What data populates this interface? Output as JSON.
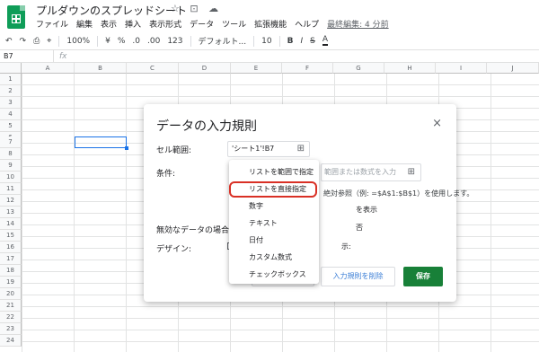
{
  "app": {
    "title": "プルダウンのスプレッドシート",
    "title_icons": "☆ ⊡ ☁",
    "menus": [
      "ファイル",
      "編集",
      "表示",
      "挿入",
      "表示形式",
      "データ",
      "ツール",
      "拡張機能",
      "ヘルプ"
    ],
    "last_edit": "最終編集: 4 分前"
  },
  "toolbar": {
    "undo": "↶",
    "redo": "↷",
    "print": "⎙",
    "paint": "⌖",
    "zoom": "100%",
    "currency": "¥",
    "percent": "%",
    "dec_less": ".0",
    "dec_more": ".00",
    "format": "123",
    "font": "デフォルト...",
    "size": "10",
    "bold": "B",
    "italic": "I",
    "strike": "S",
    "textcolor": "A"
  },
  "formula": {
    "name_box": "B7",
    "fx": "fx"
  },
  "columns": [
    "A",
    "B",
    "C",
    "D",
    "E",
    "F",
    "G",
    "H",
    "I",
    "J"
  ],
  "rows": [
    "1",
    "2",
    "3",
    "4",
    "5",
    "6",
    "7",
    "8",
    "9",
    "10",
    "11",
    "12",
    "13",
    "14",
    "15",
    "16",
    "17",
    "18",
    "19",
    "20",
    "21",
    "22",
    "23",
    "24"
  ],
  "dialog": {
    "title": "データの入力規則",
    "close": "×",
    "range_label": "セル範囲:",
    "range_value": "'シート1'!B7",
    "criteria_label": "条件:",
    "criteria_placeholder": "範囲または数式を入力",
    "hint": "絶対参照（例: =$A$1:$B$1）を使用します。",
    "show_dropdown": "を表示",
    "invalid_label": "無効なデータの場合:",
    "reject": "否",
    "design_label": "デザイン:",
    "help_text": "示:",
    "delete_button": "入力規則を削除",
    "save_button": "保存",
    "grid_icon": "⊞"
  },
  "menu": {
    "items": [
      "リストを範囲で指定",
      "リストを直接指定",
      "数字",
      "テキスト",
      "日付",
      "カスタム数式",
      "チェックボックス"
    ],
    "highlighted_index": 1
  },
  "colors": {
    "sheets_green": "#0f9d58",
    "save_green": "#188038",
    "highlight_red": "#d93025",
    "selection_blue": "#1a73e8"
  }
}
